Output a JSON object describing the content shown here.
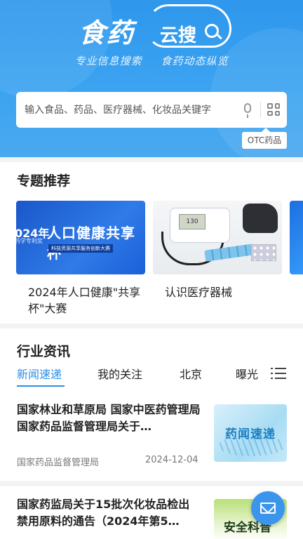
{
  "header": {
    "logo_main": "食药",
    "logo_cloud": "云搜",
    "slogans": [
      "专业信息搜索",
      "食药动态纵览"
    ],
    "search_placeholder": "输入食品、药品、医疗器械、化妆品关键字",
    "otc_label": "OTC药品"
  },
  "topics": {
    "title": "专题推荐",
    "cards": [
      {
        "label": "2024年人口健康\"共享杯\"大赛",
        "image_text": {
          "year": "024年",
          "sub": "药学专利奖",
          "main": "人口健康共享杯",
          "tag": "科技资源共享服务创新大赛"
        }
      },
      {
        "label": "认识医疗器械",
        "image_text": {
          "screen": "130"
        }
      },
      {
        "label": "",
        "image_text": {}
      }
    ]
  },
  "news": {
    "title": "行业资讯",
    "tabs": [
      "新闻速递",
      "我的关注",
      "北京",
      "曝光"
    ],
    "active_tab": 0,
    "items": [
      {
        "title": "国家林业和草原局 国家中医药管理局 国家药品监督管理局关于…",
        "source": "国家药品监督管理局",
        "date": "2024-12-04",
        "thumb_text": "药闻速递"
      },
      {
        "title": "国家药监局关于15批次化妆品检出禁用原料的通告（2024年第5…",
        "source": "",
        "date": "",
        "thumb_text": "安全科普"
      }
    ]
  },
  "colors": {
    "brand_blue": "#2f97ec",
    "active_tab": "#2a8fe8"
  }
}
